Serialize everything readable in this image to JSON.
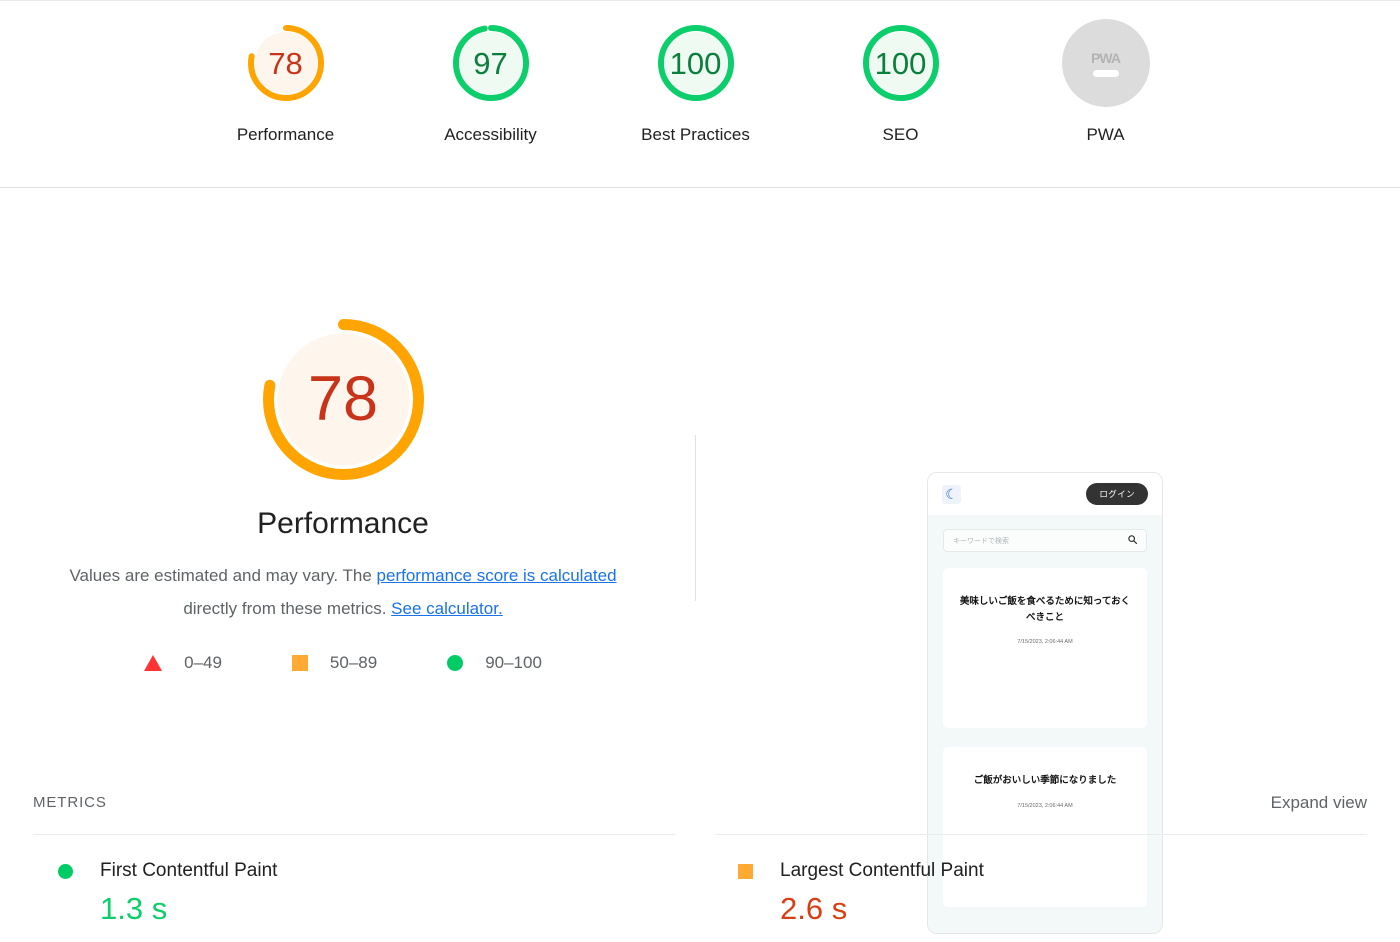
{
  "scores_bar": {
    "items": [
      {
        "label": "Performance",
        "value": "78",
        "value_color": "#c7341a",
        "arc_color": "#ffa400",
        "bg_color": "#fef6ec",
        "pct": 78
      },
      {
        "label": "Accessibility",
        "value": "97",
        "value_color": "#0b7f3c",
        "arc_color": "#0cce6b",
        "bg_color": "#eefaf2",
        "pct": 97
      },
      {
        "label": "Best Practices",
        "value": "100",
        "value_color": "#0b7f3c",
        "arc_color": "#0cce6b",
        "bg_color": "#eefaf2",
        "pct": 100
      },
      {
        "label": "SEO",
        "value": "100",
        "value_color": "#0b7f3c",
        "arc_color": "#0cce6b",
        "bg_color": "#eefaf2",
        "pct": 100
      }
    ],
    "pwa": {
      "label": "PWA",
      "badge_text": "PWA",
      "state": "not-applicable"
    }
  },
  "category": {
    "score": "78",
    "score_color": "#c7341a",
    "arc_color": "#ffa400",
    "gauge_bg": "#fef6ec",
    "pct": 78,
    "title": "Performance",
    "description_part1": "Values are estimated and may vary. The ",
    "link1": "performance score is calculated",
    "description_part2": " directly from these metrics. ",
    "link2": "See calculator.",
    "legend": [
      {
        "shape": "triangle",
        "color": "#ff3333",
        "range": "0–49"
      },
      {
        "shape": "square",
        "color": "#ffaa33",
        "range": "50–89"
      },
      {
        "shape": "circle",
        "color": "#00cc66",
        "range": "90–100"
      }
    ]
  },
  "screenshot_preview": {
    "login_button": "ログイン",
    "search_placeholder": "キーワードで検索",
    "moon_icon": "☾",
    "search_icon": "⌕",
    "posts": [
      {
        "title": "美味しいご飯を食べるために知っておくべきこと",
        "date": "7/15/2023, 2:06:44 AM"
      },
      {
        "title": "ご飯がおいしい季節になりました",
        "date": "7/15/2023, 2:06:44 AM"
      }
    ]
  },
  "metrics": {
    "section_title": "METRICS",
    "expand_view": "Expand view",
    "items": [
      {
        "name": "First Contentful Paint",
        "value": "1.3 s",
        "bullet": "circle",
        "bullet_color": "#00cc66",
        "value_color": "#0cce6b"
      },
      {
        "name": "Largest Contentful Paint",
        "value": "2.6 s",
        "bullet": "square",
        "bullet_color": "#ffaa33",
        "value_color": "#d93f12"
      }
    ]
  }
}
